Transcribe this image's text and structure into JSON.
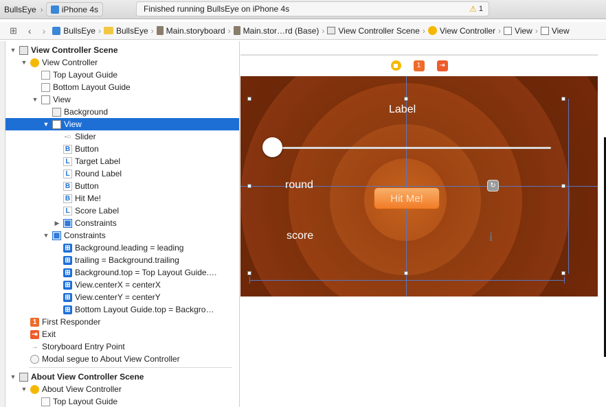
{
  "toolbar": {
    "scheme": "BullsEye",
    "device": "iPhone 4s",
    "status": "Finished running BullsEye on iPhone 4s",
    "warning_count": "1"
  },
  "jumpbar": {
    "items": [
      "BullsEye",
      "BullsEye",
      "Main.storyboard",
      "Main.stor…rd (Base)",
      "View Controller Scene",
      "View Controller",
      "View",
      "View"
    ]
  },
  "outline": {
    "rows": [
      {
        "label": "View Controller Scene",
        "indent": 0,
        "tri": "▼",
        "icon": "scene-icon",
        "bold": true
      },
      {
        "label": "View Controller",
        "indent": 1,
        "tri": "▼",
        "icon": "view-controller-icon"
      },
      {
        "label": "Top Layout Guide",
        "indent": 2,
        "tri": "",
        "icon": "layout-guide-icon"
      },
      {
        "label": "Bottom Layout Guide",
        "indent": 2,
        "tri": "",
        "icon": "layout-guide-icon"
      },
      {
        "label": "View",
        "indent": 2,
        "tri": "▼",
        "icon": "view-icon"
      },
      {
        "label": "Background",
        "indent": 3,
        "tri": "",
        "icon": "image-view-icon"
      },
      {
        "label": "View",
        "indent": 3,
        "tri": "▼",
        "icon": "view-icon",
        "selected": true
      },
      {
        "label": "Slider",
        "indent": 4,
        "tri": "",
        "icon": "slider-icon"
      },
      {
        "label": "Button",
        "indent": 4,
        "tri": "",
        "icon": "button-icon"
      },
      {
        "label": "Target Label",
        "indent": 4,
        "tri": "",
        "icon": "label-icon"
      },
      {
        "label": "Round Label",
        "indent": 4,
        "tri": "",
        "icon": "label-icon"
      },
      {
        "label": "Button",
        "indent": 4,
        "tri": "",
        "icon": "button-icon"
      },
      {
        "label": "Hit Me!",
        "indent": 4,
        "tri": "",
        "icon": "button-icon"
      },
      {
        "label": "Score Label",
        "indent": 4,
        "tri": "",
        "icon": "label-icon"
      },
      {
        "label": "Constraints",
        "indent": 4,
        "tri": "▶",
        "icon": "constraints-icon"
      },
      {
        "label": "Constraints",
        "indent": 3,
        "tri": "▼",
        "icon": "constraints-icon"
      },
      {
        "label": "Background.leading = leading",
        "indent": 4,
        "tri": "",
        "icon": "constraint-icon"
      },
      {
        "label": "trailing = Background.trailing",
        "indent": 4,
        "tri": "",
        "icon": "constraint-icon"
      },
      {
        "label": "Background.top = Top Layout Guide.…",
        "indent": 4,
        "tri": "",
        "icon": "constraint-icon"
      },
      {
        "label": "View.centerX = centerX",
        "indent": 4,
        "tri": "",
        "icon": "constraint-icon"
      },
      {
        "label": "View.centerY = centerY",
        "indent": 4,
        "tri": "",
        "icon": "constraint-icon"
      },
      {
        "label": "Bottom Layout Guide.top = Backgro…",
        "indent": 4,
        "tri": "",
        "icon": "constraint-icon"
      },
      {
        "label": "First Responder",
        "indent": 1,
        "tri": "",
        "icon": "first-responder-icon"
      },
      {
        "label": "Exit",
        "indent": 1,
        "tri": "",
        "icon": "exit-icon"
      },
      {
        "label": "Storyboard Entry Point",
        "indent": 1,
        "tri": "",
        "icon": "entry-arrow-icon"
      },
      {
        "label": "Modal segue to About View Controller",
        "indent": 1,
        "tri": "",
        "icon": "segue-icon"
      },
      {
        "label": "About View Controller Scene",
        "indent": 0,
        "tri": "▼",
        "icon": "scene-icon",
        "bold": true,
        "gap": true
      },
      {
        "label": "About View Controller",
        "indent": 1,
        "tri": "▼",
        "icon": "view-controller-icon"
      },
      {
        "label": "Top Layout Guide",
        "indent": 2,
        "tri": "",
        "icon": "layout-guide-icon"
      }
    ]
  },
  "canvas": {
    "label_text": "Label",
    "round_text": "round",
    "score_text": "score",
    "hit_button": "Hit Me!"
  },
  "colors": {
    "selection": "#1d6fd6",
    "constraint": "#5877c2",
    "button_orange": "#f17b26",
    "vc_yellow": "#f5b800"
  }
}
